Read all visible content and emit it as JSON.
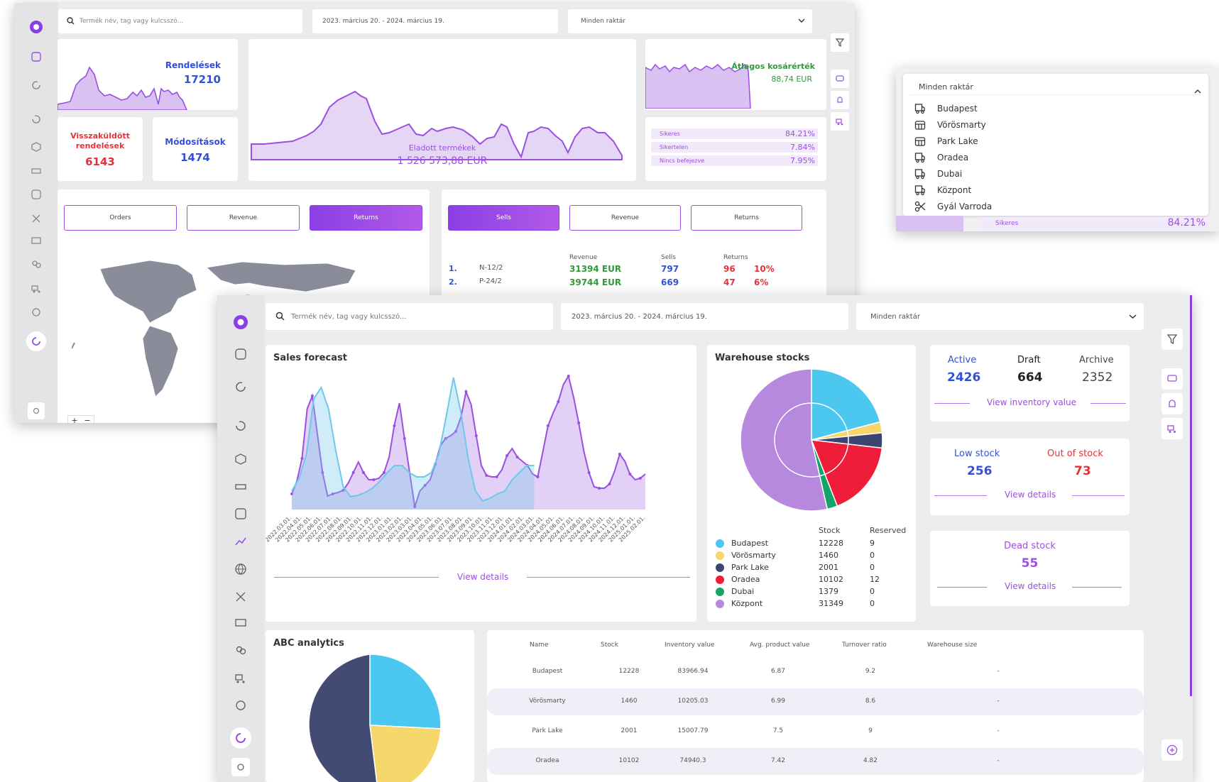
{
  "back": {
    "search_placeholder": "Termék név, tag vagy kulcsszó...",
    "date_range": "2023. március 20. - 2024. március 19.",
    "warehouse_select": "Minden raktár",
    "orders_title": "Rendelések",
    "orders_value": "17210",
    "basket_title": "Átlagos kosárérték",
    "basket_value": "88,74 EUR",
    "returned_title_1": "Visszaküldött",
    "returned_title_2": "rendelések",
    "returned_value": "6143",
    "changes_title": "Módosítások",
    "changes_value": "1474",
    "sold_title": "Eladott termékek",
    "sold_value": "1 526 573,88 EUR",
    "status": [
      {
        "label": "Sikeres",
        "value": "84.21%"
      },
      {
        "label": "Sikertelen",
        "value": "7.84%"
      },
      {
        "label": "Nincs befejezve",
        "value": "7.95%"
      }
    ],
    "left_tabs": [
      "Orders",
      "Revenue",
      "Returns"
    ],
    "right_tabs": [
      "Sells",
      "Revenue",
      "Returns"
    ],
    "rank_headers": {
      "revenue": "Revenue",
      "sells": "Sells",
      "returns": "Returns"
    },
    "rank_rows": [
      {
        "n": "1.",
        "name": "N-12/2",
        "revenue": "31394 EUR",
        "sells": "797",
        "returns": "96",
        "pct": "10%"
      },
      {
        "n": "2.",
        "name": "P-24/2",
        "revenue": "39744 EUR",
        "sells": "669",
        "returns": "47",
        "pct": "6%"
      }
    ],
    "map_zoom_in": "+",
    "map_zoom_out": "−"
  },
  "dropdown": {
    "search_value": "Minden raktár",
    "options": [
      {
        "label": "Budapest",
        "icon": "truck-icon"
      },
      {
        "label": "Vörösmarty",
        "icon": "store-icon"
      },
      {
        "label": "Park Lake",
        "icon": "store-icon"
      },
      {
        "label": "Oradea",
        "icon": "truck-icon"
      },
      {
        "label": "Dubai",
        "icon": "truck-icon"
      },
      {
        "label": "Központ",
        "icon": "truck-icon"
      },
      {
        "label": "Gyál Varroda",
        "icon": "scissors-icon"
      }
    ],
    "behind_label": "Sikeres",
    "behind_value": "84.21%"
  },
  "front": {
    "search_placeholder": "Termék név, tag vagy kulcsszó...",
    "date_range": "2023. március 20. - 2024. március 19.",
    "warehouse_select": "Minden raktár",
    "sales_forecast": {
      "title": "Sales forecast",
      "view_details": "View details",
      "x_labels": [
        "2022.03.01.",
        "2022.04.01.",
        "2022.05.01.",
        "2022.06.01.",
        "2022.07.01.",
        "2022.08.01.",
        "2022.09.01.",
        "2022.10.01.",
        "2022.11.01.",
        "2022.12.01.",
        "2023.01.01.",
        "2023.02.01.",
        "2023.03.01.",
        "2023.04.01.",
        "2023.05.01.",
        "2023.06.01.",
        "2023.07.01.",
        "2023.08.01.",
        "2023.09.01.",
        "2023.10.01.",
        "2023.11.01.",
        "2023.12.01.",
        "2024.01.01.",
        "2024.02.01.",
        "2024.03.01.",
        "2024.04.01.",
        "2024.05.01.",
        "2024.06.01.",
        "2024.07.01.",
        "2024.08.01.",
        "2024.09.01.",
        "2024.10.01.",
        "2024.11.01.",
        "2024.12.01.",
        "2025.01.01.",
        "2025.02.01."
      ]
    },
    "warehouse_stocks": {
      "title": "Warehouse stocks",
      "col_stock": "Stock",
      "col_reserved": "Reserved",
      "rows": [
        {
          "name": "Budapest",
          "stock": "12228",
          "reserved": "9",
          "color": "#4cc7ef"
        },
        {
          "name": "Vörösmarty",
          "stock": "1460",
          "reserved": "0",
          "color": "#f6d76b"
        },
        {
          "name": "Park Lake",
          "stock": "2001",
          "reserved": "0",
          "color": "#3c4472"
        },
        {
          "name": "Oradea",
          "stock": "10102",
          "reserved": "12",
          "color": "#ef1c3a"
        },
        {
          "name": "Dubai",
          "stock": "1379",
          "reserved": "0",
          "color": "#14a36b"
        },
        {
          "name": "Központ",
          "stock": "31349",
          "reserved": "0",
          "color": "#b689df"
        }
      ]
    },
    "inventory": {
      "active_label": "Active",
      "active_value": "2426",
      "draft_label": "Draft",
      "draft_value": "664",
      "archive_label": "Archive",
      "archive_value": "2352",
      "link": "View inventory value"
    },
    "stock_status": {
      "low_label": "Low stock",
      "low_value": "256",
      "out_label": "Out of stock",
      "out_value": "73",
      "link": "View details"
    },
    "dead_stock": {
      "label": "Dead stock",
      "value": "55",
      "link": "View details"
    },
    "abc": {
      "title": "ABC analytics"
    },
    "table": {
      "headers": [
        "Name",
        "Stock",
        "Inventory value",
        "Avg. product value",
        "Turnover ratio",
        "Warehouse size"
      ],
      "rows": [
        [
          "Budapest",
          "12228",
          "83966.94",
          "6.87",
          "9.2",
          "-"
        ],
        [
          "Vörösmarty",
          "1460",
          "10205.03",
          "6.99",
          "8.6",
          "-"
        ],
        [
          "Park Lake",
          "2001",
          "15007.79",
          "7.5",
          "9",
          "-"
        ],
        [
          "Oradea",
          "10102",
          "74940.3",
          "7.42",
          "4.82",
          "-"
        ]
      ]
    }
  },
  "colors": {
    "accent": "#9b4fe0",
    "blue": "#3550d8",
    "red": "#e0343a",
    "green": "#2e9a3c"
  }
}
